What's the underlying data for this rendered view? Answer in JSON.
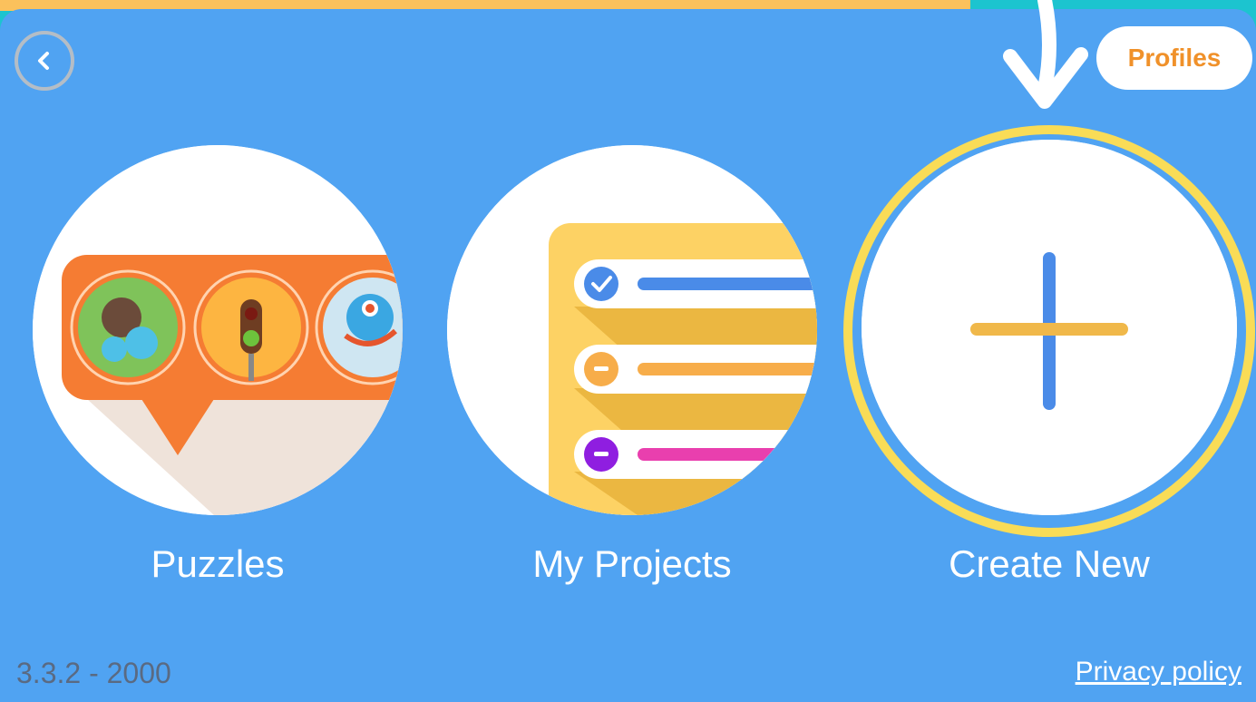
{
  "header": {
    "back_icon": "chevron-left-icon",
    "profiles_label": "Profiles",
    "arrow_icon": "down-arrow-icon"
  },
  "tiles": [
    {
      "label": "Puzzles",
      "icon": "puzzles-illustration"
    },
    {
      "label": "My Projects",
      "icon": "projects-list-illustration"
    },
    {
      "label": "Create New",
      "icon": "plus-icon"
    }
  ],
  "footer": {
    "version": "3.3.2 - 2000",
    "privacy_label": "Privacy policy"
  },
  "colors": {
    "background": "#50a3f2",
    "frame": "#1cc4cf",
    "accent_orange": "#f0912a",
    "highlight_yellow": "#f9dc57"
  }
}
